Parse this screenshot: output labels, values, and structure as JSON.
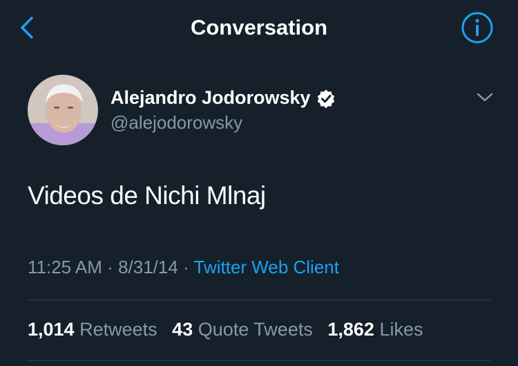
{
  "header": {
    "title": "Conversation",
    "back_icon": "chevron-left-icon",
    "info_icon": "info-circle-icon"
  },
  "tweet": {
    "author_name": "Alejandro Jodorowsky",
    "author_handle": "@alejodorowsky",
    "verified_icon": "verified-badge-icon",
    "text": "Videos de Nichi Mlnaj",
    "time": "11:25 AM",
    "separator1": "·",
    "date": "8/31/14",
    "separator2": "·",
    "client": "Twitter Web Client"
  },
  "stats": {
    "retweets_count": "1,014",
    "retweets_label": "Retweets",
    "quotes_count": "43",
    "quotes_label": "Quote Tweets",
    "likes_count": "1,862",
    "likes_label": "Likes"
  },
  "colors": {
    "background": "#15202b",
    "accent": "#1da1f2",
    "secondary_text": "#8899a6",
    "divider": "#38444d"
  }
}
